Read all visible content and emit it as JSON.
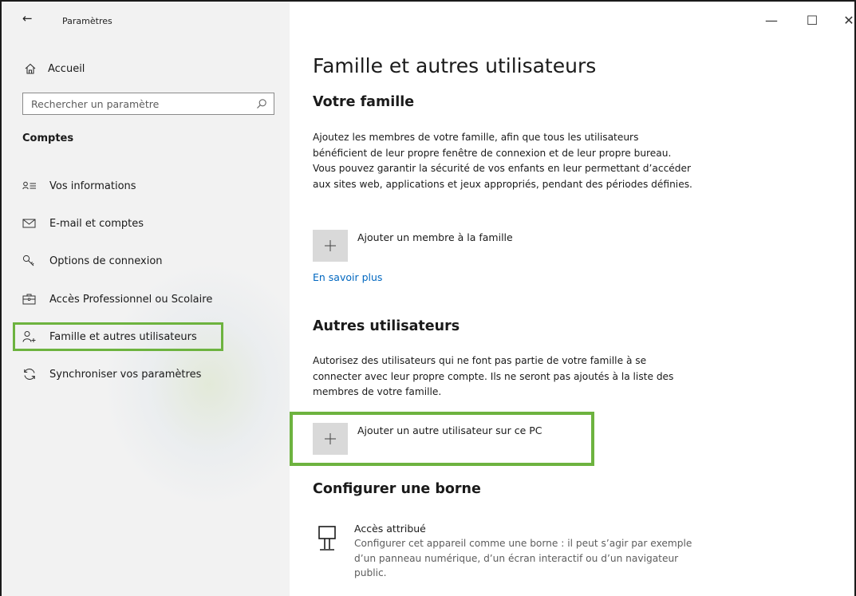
{
  "window": {
    "back_glyph": "←",
    "title": "Paramètres",
    "minimize_glyph": "—",
    "maximize_glyph": "☐",
    "close_glyph": "✕"
  },
  "sidebar": {
    "home_label": "Accueil",
    "search_placeholder": "Rechercher un paramètre",
    "section_heading": "Comptes",
    "items": [
      {
        "label": "Vos informations",
        "icon": "person-card-icon"
      },
      {
        "label": "E-mail et comptes",
        "icon": "mail-icon"
      },
      {
        "label": "Options de connexion",
        "icon": "key-icon"
      },
      {
        "label": "Accès Professionnel ou Scolaire",
        "icon": "briefcase-icon"
      },
      {
        "label": "Famille et autres utilisateurs",
        "icon": "person-add-icon",
        "selected": true
      },
      {
        "label": "Synchroniser vos paramètres",
        "icon": "sync-icon"
      }
    ]
  },
  "main": {
    "title": "Famille et autres utilisateurs",
    "family": {
      "heading": "Votre famille",
      "description": "Ajoutez les membres de votre famille, afin que tous les utilisateurs bénéficient de leur propre fenêtre de connexion et de leur propre bureau. Vous pouvez garantir la sécurité de vos enfants en leur permettant d’accéder aux sites web, applications et jeux appropriés, pendant des périodes définies.",
      "add_label": "Ajouter un membre à la famille",
      "learn_more": "En savoir plus"
    },
    "others": {
      "heading": "Autres utilisateurs",
      "description": "Autorisez des utilisateurs qui ne font pas partie de votre famille à se connecter avec leur propre compte. Ils ne seront pas ajoutés à la liste des membres de votre famille.",
      "add_label": "Ajouter un autre utilisateur sur ce PC"
    },
    "kiosk": {
      "heading": "Configurer une borne",
      "title": "Accès attribué",
      "description": "Configurer cet appareil comme une borne : il peut s’agir par exemple d’un panneau numérique, d’un écran interactif ou d’un navigateur public."
    }
  },
  "colors": {
    "highlight": "#6db33f",
    "link": "#0067c0",
    "sidebar_bg": "#f2f2f2"
  }
}
